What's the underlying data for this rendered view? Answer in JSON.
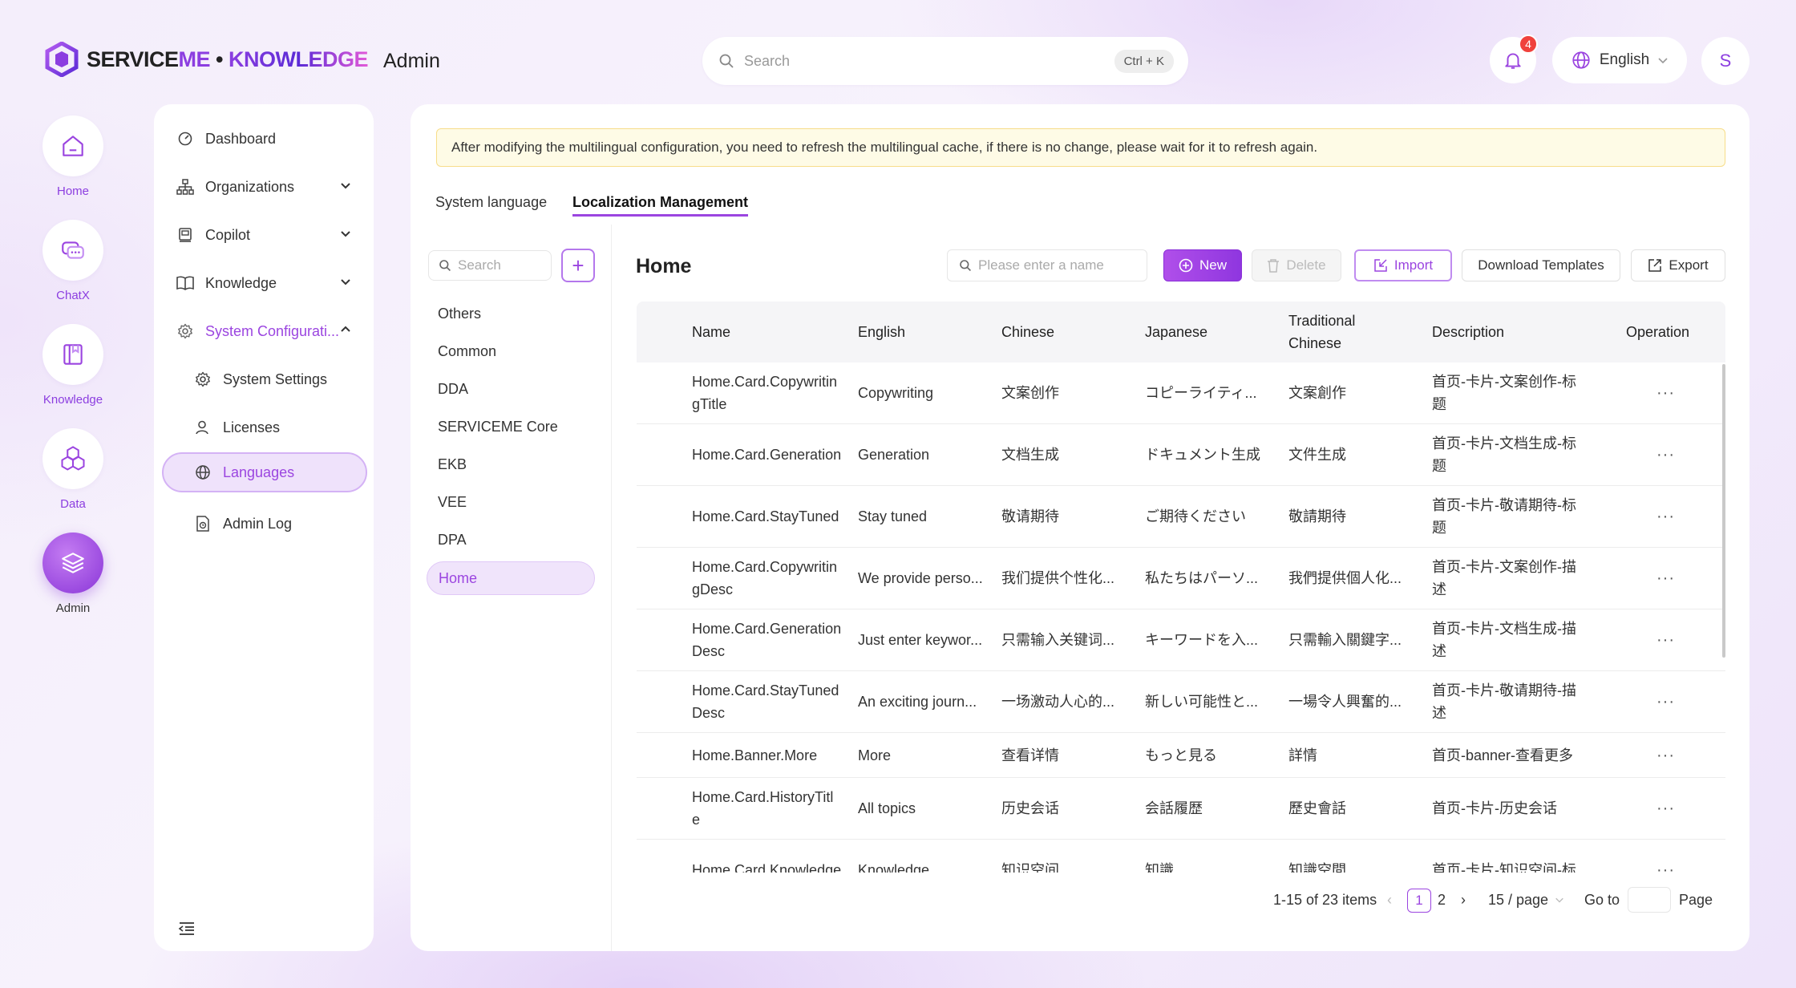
{
  "app": {
    "brand_service": "SERVICE",
    "brand_me": "ME",
    "brand_dot": " • ",
    "brand_knowledge": "KNOWLEDGE",
    "section": "Admin"
  },
  "topbar": {
    "search_placeholder": "Search",
    "search_shortcut": "Ctrl + K",
    "notification_count": "4",
    "language": "English",
    "avatar_initial": "S"
  },
  "rail": [
    {
      "label": "Home",
      "icon": "home-icon"
    },
    {
      "label": "ChatX",
      "icon": "chat-icon"
    },
    {
      "label": "Knowledge",
      "icon": "book-icon"
    },
    {
      "label": "Data",
      "icon": "hexagons-icon"
    },
    {
      "label": "Admin",
      "icon": "layers-icon",
      "active": true
    }
  ],
  "sidebar": {
    "items": [
      {
        "label": "Dashboard",
        "icon": "dashboard-icon"
      },
      {
        "label": "Organizations",
        "icon": "org-chart-icon",
        "expandable": true
      },
      {
        "label": "Copilot",
        "icon": "copilot-icon",
        "expandable": true
      },
      {
        "label": "Knowledge",
        "icon": "open-book-icon",
        "expandable": true
      },
      {
        "label": "System Configurati...",
        "icon": "gear-icon",
        "expanded": true
      },
      {
        "label": "System Settings",
        "icon": "gear-icon"
      },
      {
        "label": "Licenses",
        "icon": "user-icon"
      },
      {
        "label": "Languages",
        "icon": "globe-icon",
        "selected": true
      },
      {
        "label": "Admin Log",
        "icon": "log-icon"
      }
    ]
  },
  "notice": "After modifying the multilingual configuration, you need to refresh the multilingual cache, if there is no change, please wait for it to refresh again.",
  "tabs": [
    {
      "label": "System language"
    },
    {
      "label": "Localization Management",
      "active": true
    }
  ],
  "categories": {
    "search_placeholder": "Search",
    "add_symbol": "+",
    "items": [
      "Others",
      "Common",
      "DDA",
      "SERVICEME Core",
      "EKB",
      "VEE",
      "DPA",
      "Home"
    ],
    "selected": "Home"
  },
  "content": {
    "title": "Home",
    "name_search_placeholder": "Please enter a name",
    "buttons": {
      "new": "New",
      "delete": "Delete",
      "import": "Import",
      "download": "Download Templates",
      "export": "Export"
    }
  },
  "table": {
    "headers": {
      "name": "Name",
      "english": "English",
      "chinese": "Chinese",
      "japanese": "Japanese",
      "traditional_1": "Traditional",
      "traditional_2": "Chinese",
      "description": "Description",
      "operation": "Operation"
    },
    "rows": [
      {
        "name1": "Home.Card.Copywritin",
        "name2": "gTitle",
        "en": "Copywriting",
        "zh": "文案创作",
        "ja": "コピーライティ...",
        "tw": "文案創作",
        "desc1": "首页-卡片-文案创作-标",
        "desc2": "题",
        "op": "···"
      },
      {
        "name1": "Home.Card.Generation",
        "name2": "",
        "en": "Generation",
        "zh": "文档生成",
        "ja": "ドキュメント生成",
        "tw": "文件生成",
        "desc1": "首页-卡片-文档生成-标",
        "desc2": "题",
        "op": "···"
      },
      {
        "name1": "Home.Card.StayTuned",
        "name2": "",
        "en": "Stay tuned",
        "zh": "敬请期待",
        "ja": "ご期待ください",
        "tw": "敬請期待",
        "desc1": "首页-卡片-敬请期待-标",
        "desc2": "题",
        "op": "···"
      },
      {
        "name1": "Home.Card.Copywritin",
        "name2": "gDesc",
        "en": "We provide perso...",
        "zh": "我们提供个性化...",
        "ja": "私たちはパーソ...",
        "tw": "我們提供個人化...",
        "desc1": "首页-卡片-文案创作-描",
        "desc2": "述",
        "op": "···"
      },
      {
        "name1": "Home.Card.Generation",
        "name2": "Desc",
        "en": "Just enter keywor...",
        "zh": "只需输入关键词...",
        "ja": "キーワードを入...",
        "tw": "只需輸入關鍵字...",
        "desc1": "首页-卡片-文档生成-描",
        "desc2": "述",
        "op": "···"
      },
      {
        "name1": "Home.Card.StayTuned",
        "name2": "Desc",
        "en": "An exciting journ...",
        "zh": "一场激动人心的...",
        "ja": "新しい可能性と...",
        "tw": "一場令人興奮的...",
        "desc1": "首页-卡片-敬请期待-描",
        "desc2": "述",
        "op": "···"
      },
      {
        "name1": "Home.Banner.More",
        "name2": "",
        "en": "More",
        "zh": "查看详情",
        "ja": "もっと見る",
        "tw": "詳情",
        "desc1": "首页-banner-查看更多",
        "desc2": "",
        "op": "···"
      },
      {
        "name1": "Home.Card.HistoryTitl",
        "name2": "e",
        "en": "All topics",
        "zh": "历史会话",
        "ja": "会話履歴",
        "tw": "歷史會話",
        "desc1": "首页-卡片-历史会话",
        "desc2": "",
        "op": "···"
      },
      {
        "name1": "Home.Card.Knowledge",
        "name2": "",
        "en": "Knowledge",
        "zh": "知识空间",
        "ja": "知識",
        "tw": "知識空間",
        "desc1": "首页-卡片-知识空间-标",
        "desc2": "",
        "op": "···"
      }
    ]
  },
  "pagination": {
    "summary": "1-15 of 23 items",
    "prev": "‹",
    "current_page": "1",
    "page_2": "2",
    "next": "›",
    "page_size": "15 / page",
    "goto_label": "Go to",
    "page_label": "Page"
  },
  "colors": {
    "accent": "#9b45e0",
    "notice_bg": "#fefbe6",
    "badge": "#f0413c"
  }
}
